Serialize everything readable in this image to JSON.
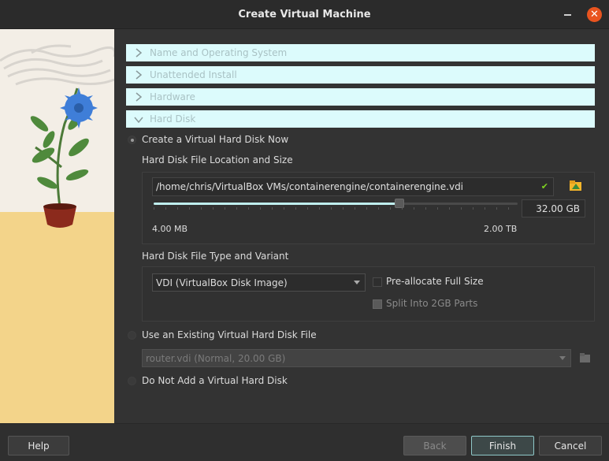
{
  "window": {
    "title": "Create Virtual Machine"
  },
  "sections": [
    {
      "label": "Name and Operating System",
      "expanded": false
    },
    {
      "label": "Unattended Install",
      "expanded": false
    },
    {
      "label": "Hardware",
      "expanded": false
    },
    {
      "label": "Hard Disk",
      "expanded": true
    }
  ],
  "hard_disk": {
    "create_option": {
      "label": "Create a Virtual Hard Disk Now",
      "checked": true
    },
    "location_title": "Hard Disk File Location and Size",
    "file_path": "/home/chris/VirtualBox VMs/containerengine/containerengine.vdi",
    "size_value": "32.00 GB",
    "size_min": "4.00 MB",
    "size_max": "2.00 TB",
    "type_title": "Hard Disk File Type and Variant",
    "type_selected": "VDI (VirtualBox Disk Image)",
    "preallocate_label": "Pre-allocate Full Size",
    "split_label": "Split Into 2GB Parts",
    "existing_option": {
      "label": "Use an Existing Virtual Hard Disk File",
      "checked": false
    },
    "existing_selected": "router.vdi (Normal, 20.00 GB)",
    "no_disk_option": {
      "label": "Do Not Add a Virtual Hard Disk",
      "checked": false
    }
  },
  "buttons": {
    "help": "Help",
    "back": "Back",
    "finish": "Finish",
    "cancel": "Cancel"
  },
  "colors": {
    "accent": "#dcfbfc",
    "close": "#e9541f"
  }
}
